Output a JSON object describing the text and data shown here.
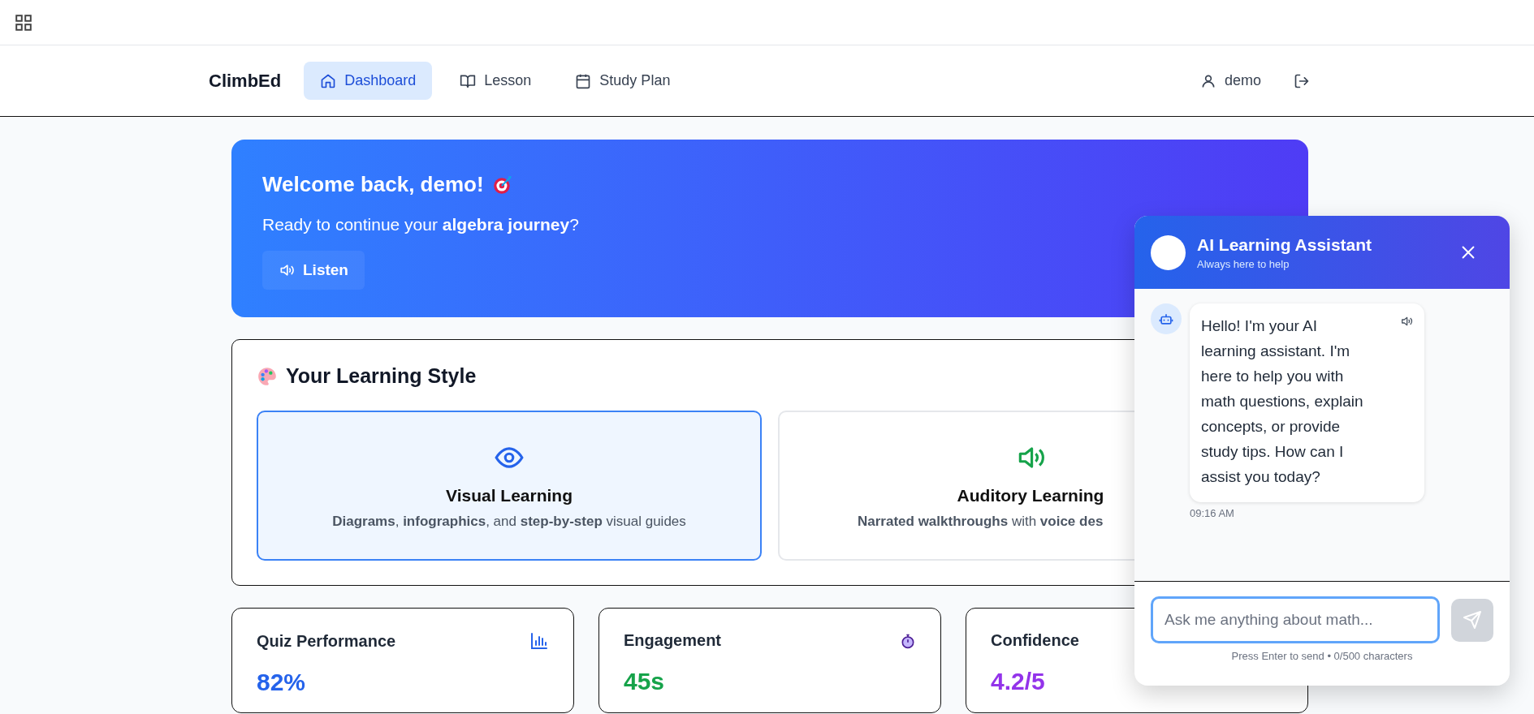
{
  "nav": {
    "brand": "ClimbEd",
    "tabs": [
      {
        "label": "Dashboard",
        "selected": true
      },
      {
        "label": "Lesson",
        "selected": false
      },
      {
        "label": "Study Plan",
        "selected": false
      }
    ],
    "user": "demo"
  },
  "hero": {
    "title": "Welcome back, demo!",
    "subtitle": "Ready to continue your **algebra journey**?",
    "listen_button": "Listen"
  },
  "learning_style": {
    "title": "Your Learning Style",
    "options": [
      {
        "kind": "visual",
        "title": "Visual Learning",
        "description": "**Diagrams**, **infographics**, and **step-by-step** visual guides",
        "selected": true
      },
      {
        "kind": "auditory",
        "title": "Auditory Learning",
        "description": "**Narrated walkthroughs** with **voice des**",
        "selected": false
      }
    ]
  },
  "stats": [
    {
      "kind": "quiz",
      "label": "Quiz Performance",
      "value": "82%",
      "color": "#2563eb"
    },
    {
      "kind": "engagement",
      "label": "Engagement",
      "value": "45s",
      "color": "#16a34a"
    },
    {
      "kind": "confidence",
      "label": "Confidence",
      "value": "4.2/5",
      "color": "#9333ea"
    }
  ],
  "chat": {
    "title": "AI Learning Assistant",
    "subtitle": "Always here to help",
    "messages": [
      {
        "text": "Hello! I'm your AI learning assistant. I'm here to help you with math questions, explain concepts, or provide study tips. How can I assist you today?",
        "time": "09:16 AM"
      }
    ],
    "input": {
      "placeholder": "Ask me anything about math..."
    },
    "hint": "Press Enter to send • 0/500 characters"
  }
}
